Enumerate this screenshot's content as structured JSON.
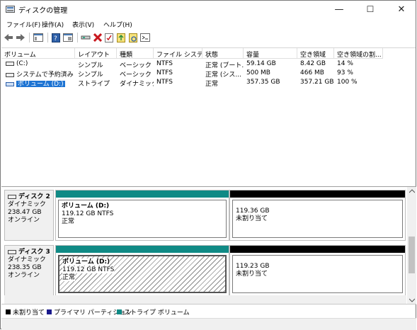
{
  "window": {
    "title": "ディスクの管理",
    "minimize": "—",
    "maximize": "☐",
    "close": "✕"
  },
  "menu": [
    "ファイル(F)",
    "操作(A)",
    "表示(V)",
    "ヘルプ(H)"
  ],
  "toolbar": [
    "back-arrow-icon",
    "forward-arrow-icon",
    "console-tree-icon",
    "help-icon",
    "properties-icon",
    "connect-icon",
    "delete-icon",
    "check-icon",
    "new-volume-icon",
    "rescan-icon",
    "console-icon"
  ],
  "table": {
    "headers": [
      "ボリューム",
      "レイアウト",
      "種類",
      "ファイル システム",
      "状態",
      "容量",
      "空き領域",
      "空き領域の割..."
    ],
    "rows": [
      [
        "(C:)",
        "シンプル",
        "ベーシック",
        "NTFS",
        "正常 (ブート...",
        "59.14 GB",
        "8.42 GB",
        "14 %"
      ],
      [
        "システムで予約済み",
        "シンプル",
        "ベーシック",
        "NTFS",
        "正常 (シス...",
        "500 MB",
        "466 MB",
        "93 %"
      ],
      [
        "ボリューム (D:)",
        "ストライプ",
        "ダイナミック",
        "NTFS",
        "正常",
        "357.35 GB",
        "357.21 GB",
        "100 %"
      ]
    ]
  },
  "disks": [
    {
      "name": "ディスク 2",
      "type": "ダイナミック",
      "size": "238.47 GB",
      "status": "オンライン",
      "vol_name": "ボリューム (D:)",
      "vol_info": "119.12 GB NTFS",
      "vol_status": "正常",
      "unalloc_size": "119.36 GB",
      "unalloc_label": "未割り当て"
    },
    {
      "name": "ディスク 3",
      "type": "ダイナミック",
      "size": "238.35 GB",
      "status": "オンライン",
      "vol_name": "ボリューム (D:)",
      "vol_info": "119.12 GB NTFS",
      "vol_status": "正常",
      "unalloc_size": "119.23 GB",
      "unalloc_label": "未割り当て"
    }
  ],
  "legend": [
    {
      "label": "未割り当て",
      "color": "#000000"
    },
    {
      "label": "プライマリ パーティション",
      "color": "#1a1a8c"
    },
    {
      "label": "ストライプ ボリューム",
      "color": "#0f8a85"
    }
  ],
  "colors": {
    "stripe": "#0f8a85",
    "unallocated": "#000000",
    "selection": "#1e74d3"
  }
}
